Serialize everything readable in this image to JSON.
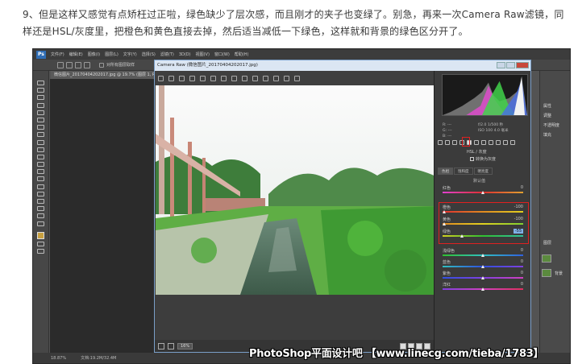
{
  "article": {
    "text": "9、但是这样又感觉有点矫枉过正啦，绿色缺少了层次感，而且刚才的夹子也变绿了。别急，再来一次Camera Raw滤镜，同样还是HSL/灰度里，把橙色和黄色直接去掉，然后适当减低一下绿色，这样就和背景的绿色区分开了。"
  },
  "photoshop": {
    "logo": "Ps",
    "menu": [
      "文件(F)",
      "编辑(E)",
      "图像(I)",
      "图层(L)",
      "文字(Y)",
      "选择(S)",
      "滤镜(T)",
      "3D(D)",
      "视图(V)",
      "窗口(W)",
      "帮助(H)"
    ],
    "option_checkbox_label": "对所有图层取样",
    "doc_tab": "微信图片_20170404202017.jpg @ 19.7% (图层 1, RGB/8)",
    "status_zoom": "18.87%",
    "status_doc": "文档:19.2M/32.4M",
    "layers_label": "图层",
    "background_layer": "背景",
    "right_side_labels": [
      "属性",
      "调整",
      "不透明度",
      "填充"
    ]
  },
  "camera_raw": {
    "title": "Camera Raw (微信图片_20170404202017.jpg)",
    "readout": {
      "r": "R: ---",
      "g": "G: ---",
      "b": "B: ---",
      "aperture": "f/2.0",
      "shutter": "1/500 秒",
      "iso": "ISO 100",
      "focal": "4.0 毫米"
    },
    "section_title": "HSL / 灰度",
    "convert_label": "转换为灰度",
    "subtabs": [
      "色相",
      "饱和度",
      "明亮度"
    ],
    "default_label": "默认值",
    "sliders": [
      {
        "label": "红色",
        "value": "0"
      },
      {
        "label": "橙色",
        "value": "-100"
      },
      {
        "label": "黄色",
        "value": "-100"
      },
      {
        "label": "绿色",
        "value": "-55"
      },
      {
        "label": "浅绿色",
        "value": "0"
      },
      {
        "label": "蓝色",
        "value": "0"
      },
      {
        "label": "紫色",
        "value": "0"
      },
      {
        "label": "洋红",
        "value": "0"
      }
    ],
    "zoom_level": "16%",
    "colors": {
      "highlight_box": "#e02020",
      "title_bar": "#dbe6f3",
      "panel_bg": "#3b3b3b"
    }
  },
  "watermark": "PhotoShop平面设计吧 【www.linecg.com/tieba/1783】"
}
